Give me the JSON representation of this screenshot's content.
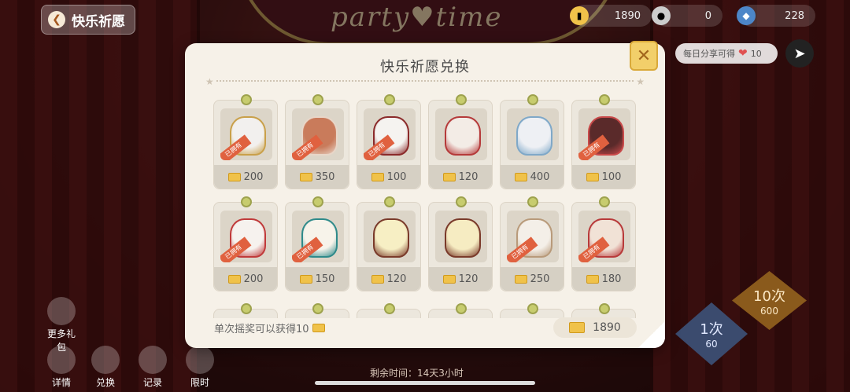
{
  "background": {
    "title": "party♥time",
    "back_label": "快乐祈愿",
    "currencies": [
      {
        "icon": "coupon-icon",
        "value": "1890"
      },
      {
        "icon": "coin-icon",
        "value": "0"
      },
      {
        "icon": "diamond-icon",
        "value": "228"
      }
    ],
    "share_tip": "每日分享可得",
    "share_reward": "10",
    "left_buttons": [
      "详情",
      "兑换",
      "记录",
      "限时"
    ],
    "side_label": "更多礼包",
    "remaining_time": "剩余时间：14天3小时",
    "spin_ten": {
      "label": "10次",
      "cost": "600"
    },
    "spin_one": {
      "label": "1次",
      "cost": "60"
    }
  },
  "modal": {
    "title": "快乐祈愿兑换",
    "owned_label": "已拥有",
    "items": [
      {
        "price": "200",
        "owned": true,
        "color": "#f2f0ee",
        "accent": "#c9a04a"
      },
      {
        "price": "350",
        "owned": true,
        "color": "#c97b5b",
        "accent": "#e8d6c8"
      },
      {
        "price": "100",
        "owned": true,
        "color": "#f5f3f0",
        "accent": "#8b2a2a"
      },
      {
        "price": "120",
        "owned": false,
        "color": "#f3ece6",
        "accent": "#b53a3a"
      },
      {
        "price": "400",
        "owned": false,
        "color": "#eef0f4",
        "accent": "#7fa8c8"
      },
      {
        "price": "100",
        "owned": true,
        "color": "#5a2a2a",
        "accent": "#c94a4a"
      },
      {
        "price": "200",
        "owned": true,
        "color": "#f6f2ee",
        "accent": "#c03a3a"
      },
      {
        "price": "150",
        "owned": true,
        "color": "#f7f3ea",
        "accent": "#2e8a8a"
      },
      {
        "price": "120",
        "owned": false,
        "color": "#f7efc4",
        "accent": "#7a3a2a"
      },
      {
        "price": "120",
        "owned": false,
        "color": "#f6ecc2",
        "accent": "#7a3a2a"
      },
      {
        "price": "250",
        "owned": true,
        "color": "#f4efe8",
        "accent": "#b89a7a"
      },
      {
        "price": "180",
        "owned": true,
        "color": "#f1e2d6",
        "accent": "#b83a3a"
      }
    ],
    "footer_text": "单次摇奖可以获得10",
    "balance": "1890"
  }
}
